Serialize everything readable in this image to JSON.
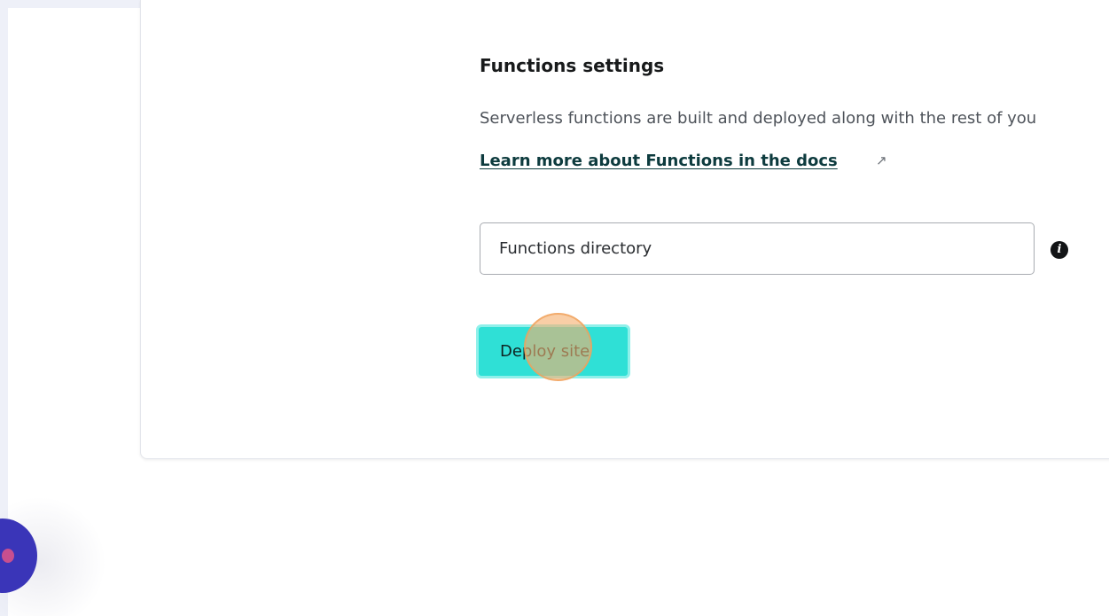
{
  "functions_settings": {
    "title": "Functions settings",
    "description": "Serverless functions are built and deployed along with the rest of you",
    "docs_link_label": "Learn more about Functions in the docs",
    "external_link_icon": "↗",
    "directory_input": {
      "placeholder": "Functions directory",
      "value": ""
    },
    "info_icon": "i",
    "deploy_button_label": "Deploy site"
  },
  "colors": {
    "accent": "#2fe0d6",
    "link": "#0d3b3e",
    "chat_launcher": "#3a35b8",
    "click_indicator": "#f6b070"
  }
}
